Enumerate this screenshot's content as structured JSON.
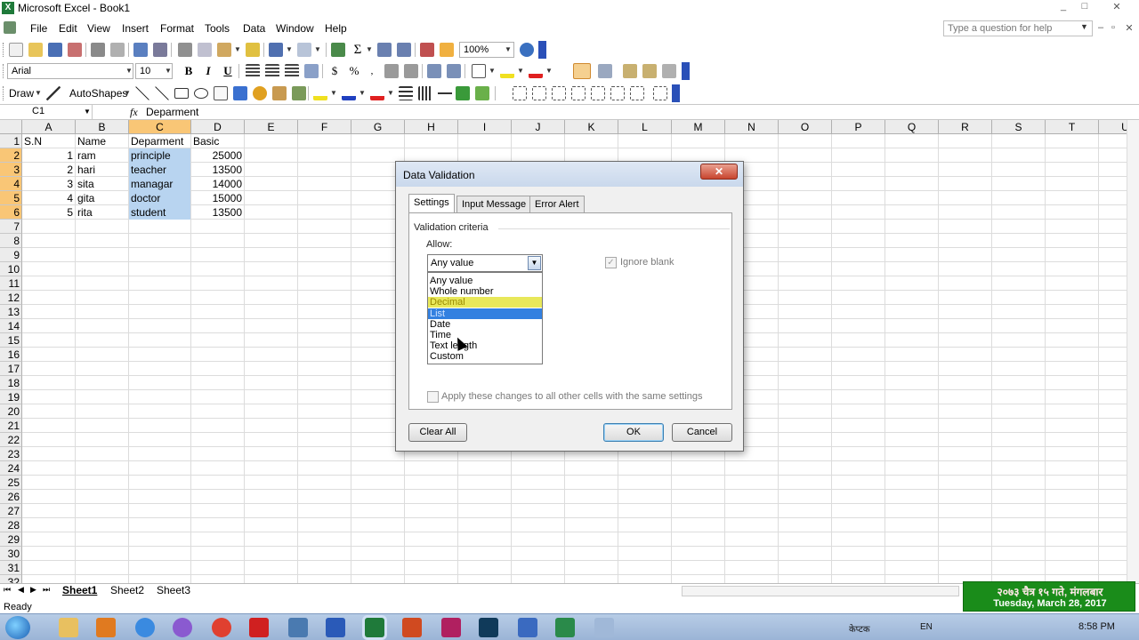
{
  "window": {
    "title": "Microsoft Excel - Book1",
    "app_icon": "X",
    "controls": [
      "_",
      "□",
      "✕"
    ]
  },
  "menubar": {
    "items": [
      "File",
      "Edit",
      "View",
      "Insert",
      "Format",
      "Tools",
      "Data",
      "Window",
      "Help"
    ],
    "help_placeholder": "Type a question for help",
    "doc_controls": [
      "–",
      "▫",
      "✕"
    ]
  },
  "standard_toolbar": {
    "zoom": "100%",
    "icons": [
      "new-icon",
      "open-icon",
      "save-icon",
      "permission-icon",
      "print-icon",
      "print-preview-icon",
      "spelling-icon",
      "research-icon",
      "cut-icon",
      "copy-icon",
      "paste-icon",
      "format-painter-icon",
      "undo-icon",
      "redo-icon",
      "hyperlink-icon",
      "autosum-icon",
      "sort-asc-icon",
      "sort-desc-icon",
      "chart-wizard-icon",
      "drawing-icon",
      "help-icon"
    ]
  },
  "formatting_toolbar": {
    "font": "Arial",
    "size": "10",
    "bold": "B",
    "italic": "I",
    "underline": "U"
  },
  "drawing_toolbar": {
    "draw_label": "Draw",
    "autoshapes_label": "AutoShapes"
  },
  "formula_bar": {
    "name_box": "C1",
    "fx": "fx",
    "content": "Deparment"
  },
  "sheet": {
    "columns": [
      "A",
      "B",
      "C",
      "D",
      "E",
      "F",
      "G",
      "H",
      "I",
      "J",
      "K",
      "L",
      "M",
      "N",
      "O",
      "P",
      "Q",
      "R",
      "S",
      "T",
      "U"
    ],
    "rows": [
      "1",
      "2",
      "3",
      "4",
      "5",
      "6",
      "7",
      "8",
      "9",
      "10",
      "11",
      "12",
      "13",
      "14",
      "15",
      "16",
      "17",
      "18",
      "19",
      "20",
      "21",
      "22",
      "23",
      "24",
      "25",
      "26",
      "27",
      "28",
      "29",
      "30",
      "31",
      "32"
    ],
    "selected_column": "C",
    "data": [
      [
        "S.N",
        "Name",
        "Deparment",
        "Basic"
      ],
      [
        "1",
        "ram",
        "principle",
        "25000"
      ],
      [
        "2",
        "hari",
        "teacher",
        "13500"
      ],
      [
        "3",
        "sita",
        "managar",
        "14000"
      ],
      [
        "4",
        "gita",
        "doctor",
        "15000"
      ],
      [
        "5",
        "rita",
        "student",
        "13500"
      ]
    ]
  },
  "sheet_tabs": {
    "tabs": [
      "Sheet1",
      "Sheet2",
      "Sheet3"
    ],
    "active": "Sheet1",
    "nav": [
      "⏮",
      "◀",
      "▶",
      "⏭"
    ]
  },
  "status": {
    "text": "Ready"
  },
  "date_widget": {
    "nepali": "२०७३ चैत्र १५ गते, मंगलबार",
    "english": "Tuesday, March 28, 2017"
  },
  "taskbar": {
    "lang": "EN",
    "tray_label": "केप्टक",
    "clock": "8:58 PM"
  },
  "dialog": {
    "title": "Data Validation",
    "close": "✕",
    "tabs": [
      "Settings",
      "Input Message",
      "Error Alert"
    ],
    "active_tab": "Settings",
    "group_label": "Validation criteria",
    "allow_label": "Allow:",
    "allow_value": "Any value",
    "options": [
      "Any value",
      "Whole number",
      "Decimal",
      "List",
      "Date",
      "Time",
      "Text length",
      "Custom"
    ],
    "selected_option": "List",
    "hover_option": "Decimal",
    "ignore_blank_label": "Ignore blank",
    "ignore_blank_checked": true,
    "apply_label": "Apply these changes to all other cells with the same settings",
    "clear_all": "Clear All",
    "ok": "OK",
    "cancel": "Cancel"
  },
  "colors": {
    "selected_header": "#f9c676",
    "range_highlight": "#b8d4f0",
    "dropdown_selected": "#3380e0",
    "dropdown_hover": "#e8e85a",
    "date_widget_bg": "#1a8c1a"
  }
}
